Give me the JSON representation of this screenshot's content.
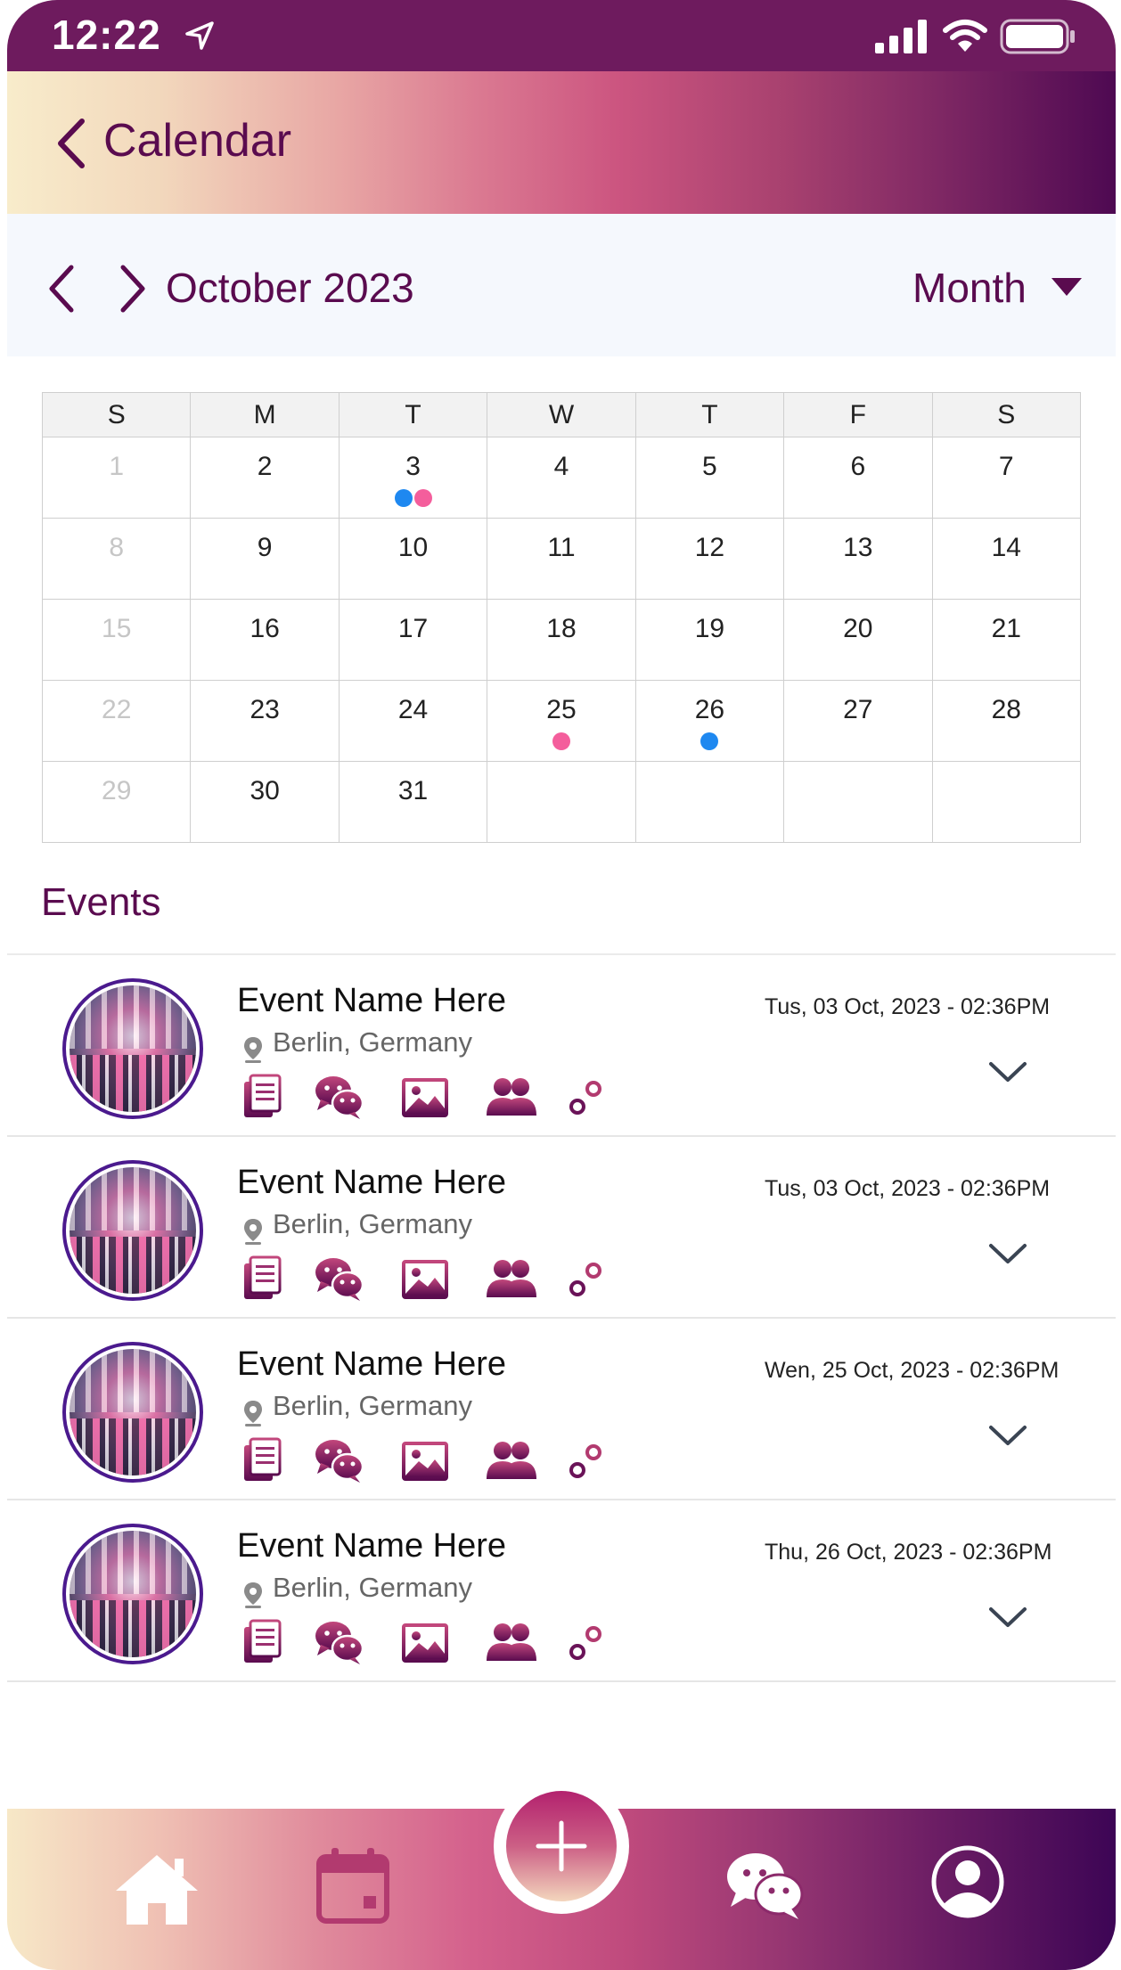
{
  "status_bar": {
    "time": "12:22"
  },
  "header": {
    "title": "Calendar"
  },
  "month_bar": {
    "month_label": "October 2023",
    "view": "Month"
  },
  "calendar": {
    "weekdays": [
      "S",
      "M",
      "T",
      "W",
      "T",
      "F",
      "S"
    ],
    "weeks": [
      [
        "1",
        "2",
        "3",
        "4",
        "5",
        "6",
        "7"
      ],
      [
        "8",
        "9",
        "10",
        "11",
        "12",
        "13",
        "14"
      ],
      [
        "15",
        "16",
        "17",
        "18",
        "19",
        "20",
        "21"
      ],
      [
        "22",
        "23",
        "24",
        "25",
        "26",
        "27",
        "28"
      ],
      [
        "29",
        "30",
        "31",
        "",
        "",
        "",
        ""
      ]
    ],
    "markers": {
      "3": [
        "#1e88f0",
        "#f45e9c"
      ],
      "25": [
        "#f45e9c"
      ],
      "26": [
        "#1e88f0"
      ]
    }
  },
  "events": {
    "title": "Events",
    "items": [
      {
        "name": "Event Name Here",
        "location": "Berlin, Germany",
        "date": "Tus, 03 Oct, 2023 - 02:36PM"
      },
      {
        "name": "Event Name Here",
        "location": "Berlin, Germany",
        "date": "Tus, 03 Oct, 2023 - 02:36PM"
      },
      {
        "name": "Event Name Here",
        "location": "Berlin, Germany",
        "date": "Wen, 25 Oct, 2023 - 02:36PM"
      },
      {
        "name": "Event Name Here",
        "location": "Berlin, Germany",
        "date": "Thu, 26 Oct, 2023 - 02:36PM"
      }
    ]
  },
  "colors": {
    "primary": "#5a0b4f",
    "status_bar": "#6e1b5e",
    "dot_blue": "#1e88f0",
    "dot_pink": "#f45e9c",
    "avatar_border": "#4b1a8e"
  },
  "icons": {
    "status": [
      "location-arrow-icon",
      "signal-icon",
      "wifi-icon",
      "battery-icon"
    ],
    "event_actions": [
      "notes-icon",
      "chat-icon",
      "gallery-icon",
      "people-icon",
      "settings-sliders-icon"
    ],
    "bottom_nav": [
      "home-icon",
      "calendar-icon",
      "plus-icon",
      "chat-icon",
      "profile-icon"
    ]
  }
}
